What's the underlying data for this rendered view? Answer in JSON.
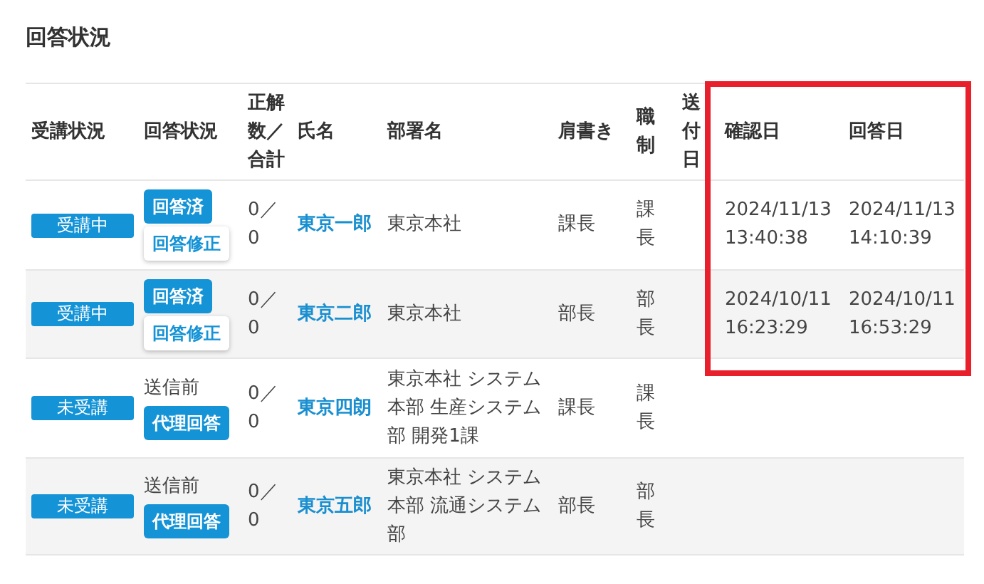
{
  "title": "回答状況",
  "columns": [
    {
      "label": "受講状況",
      "highlighted": false
    },
    {
      "label": "回答状況",
      "highlighted": false
    },
    {
      "label": "正解数／合計",
      "highlighted": false
    },
    {
      "label": "氏名",
      "highlighted": false
    },
    {
      "label": "部署名",
      "highlighted": false
    },
    {
      "label": "肩書き",
      "highlighted": false
    },
    {
      "label": "職制",
      "highlighted": false
    },
    {
      "label": "送付日",
      "highlighted": false
    },
    {
      "label": "確認日",
      "highlighted": true
    },
    {
      "label": "回答日",
      "highlighted": true
    }
  ],
  "rows": [
    {
      "highlighted": true,
      "status": "受講中",
      "answer_text": "",
      "actions": [
        {
          "label": "回答済",
          "kind": "filled"
        },
        {
          "label": "回答修正",
          "kind": "outline"
        }
      ],
      "score": "0／0",
      "name": "東京一郎",
      "department": "東京本社",
      "title": "課長",
      "rank": "課長",
      "confirmed": "2024/11/13 13:40:38",
      "answered": "2024/11/13 14:10:39"
    },
    {
      "highlighted": true,
      "status": "受講中",
      "answer_text": "",
      "actions": [
        {
          "label": "回答済",
          "kind": "filled"
        },
        {
          "label": "回答修正",
          "kind": "outline"
        }
      ],
      "score": "0／0",
      "name": "東京二郎",
      "department": "東京本社",
      "title": "部長",
      "rank": "部長",
      "confirmed": "2024/10/11 16:23:29",
      "answered": "2024/10/11 16:53:29"
    },
    {
      "highlighted": false,
      "status": "未受講",
      "answer_text": "送信前",
      "actions": [
        {
          "label": "代理回答",
          "kind": "filled"
        }
      ],
      "score": "0／0",
      "name": "東京四朗",
      "department": "東京本社 システム本部 生産システム部 開発1課",
      "title": "課長",
      "rank": "課長",
      "confirmed": "",
      "answered": ""
    },
    {
      "highlighted": false,
      "status": "未受講",
      "answer_text": "送信前",
      "actions": [
        {
          "label": "代理回答",
          "kind": "filled"
        }
      ],
      "score": "0／0",
      "name": "東京五郎",
      "department": "東京本社 システム本部 流通システム部",
      "title": "部長",
      "rank": "部長",
      "confirmed": "",
      "answered": ""
    }
  ]
}
